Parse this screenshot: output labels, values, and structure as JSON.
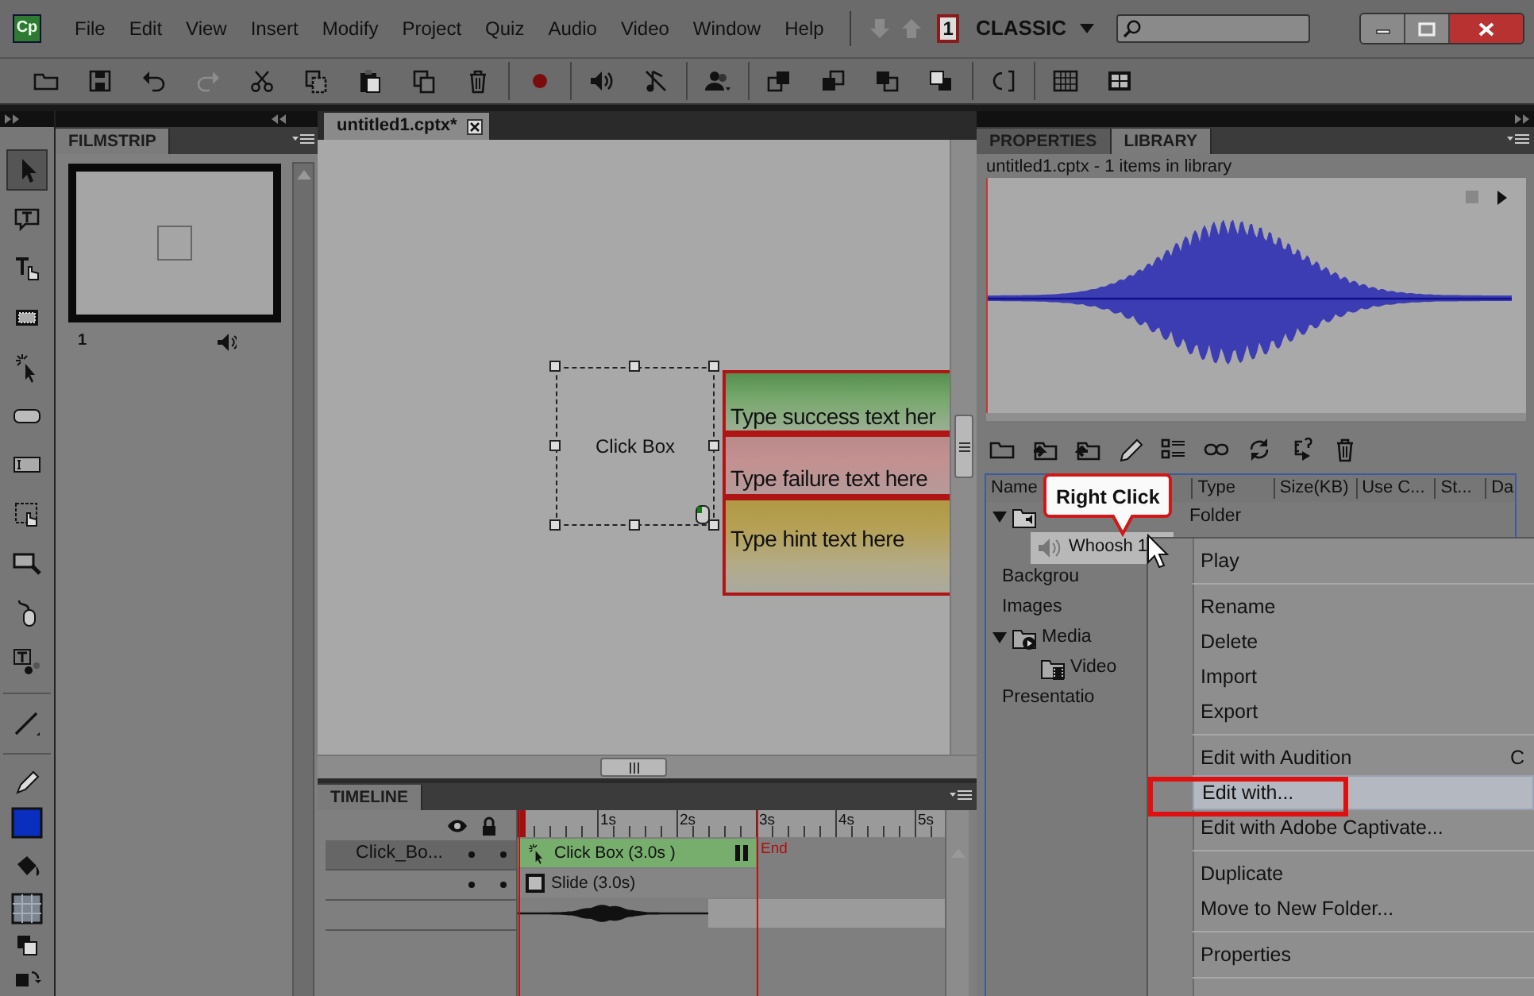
{
  "app": {
    "logo": "Cp",
    "menus": [
      "File",
      "Edit",
      "View",
      "Insert",
      "Modify",
      "Project",
      "Quiz",
      "Audio",
      "Video",
      "Window",
      "Help"
    ],
    "nav_arrows": [
      {
        "kind": "down",
        "disabled": true
      },
      {
        "kind": "up",
        "disabled": true
      }
    ],
    "page_indicator": "1",
    "workspace": "CLASSIC"
  },
  "toolbar": [
    {
      "kind": "open",
      "disabled": false
    },
    {
      "kind": "save",
      "disabled": false
    },
    {
      "kind": "undo",
      "disabled": false
    },
    {
      "kind": "redo",
      "disabled": true
    },
    {
      "kind": "cut",
      "disabled": false
    },
    {
      "kind": "copy",
      "disabled": false
    },
    {
      "kind": "paste",
      "disabled": false
    },
    {
      "kind": "duplicate",
      "disabled": false
    },
    {
      "kind": "delete",
      "disabled": false
    },
    {
      "kind": "sep"
    },
    {
      "kind": "record",
      "disabled": false
    },
    {
      "kind": "sep"
    },
    {
      "kind": "audio",
      "disabled": false
    },
    {
      "kind": "note",
      "disabled": false
    },
    {
      "kind": "sep"
    },
    {
      "kind": "people",
      "disabled": false
    },
    {
      "kind": "sep"
    },
    {
      "kind": "front",
      "disabled": false
    },
    {
      "kind": "forward",
      "disabled": false
    },
    {
      "kind": "backward",
      "disabled": false
    },
    {
      "kind": "back",
      "disabled": false
    },
    {
      "kind": "sep"
    },
    {
      "kind": "bracket",
      "disabled": false
    },
    {
      "kind": "sep"
    },
    {
      "kind": "grid",
      "disabled": false
    },
    {
      "kind": "grid2",
      "disabled": false
    }
  ],
  "tools": [
    {
      "kind": "pointer",
      "selected": true
    },
    {
      "kind": "caption",
      "selected": false
    },
    {
      "kind": "rollover",
      "selected": false
    },
    {
      "kind": "highlight",
      "selected": false
    },
    {
      "kind": "click",
      "selected": false
    },
    {
      "kind": "button",
      "selected": false
    },
    {
      "kind": "entry",
      "selected": false
    },
    {
      "kind": "area",
      "selected": false
    },
    {
      "kind": "zoom",
      "selected": false
    },
    {
      "kind": "mouse",
      "selected": false
    },
    {
      "kind": "smart",
      "selected": false
    },
    {
      "kind": "sep"
    },
    {
      "kind": "line",
      "selected": false
    },
    {
      "kind": "sep"
    },
    {
      "kind": "pencil",
      "selected": false
    },
    {
      "kind": "stroke",
      "color": "#0a2ebd"
    },
    {
      "kind": "fill",
      "selected": false
    },
    {
      "kind": "fillswatch"
    },
    {
      "kind": "defaults"
    },
    {
      "kind": "swap"
    }
  ],
  "filmstrip": {
    "tab": "FILMSTRIP",
    "slides": [
      {
        "number": "1",
        "selected": true,
        "audio": true
      }
    ]
  },
  "document": {
    "tab": "untitled1.cptx*",
    "click_box": {
      "label": "Click Box",
      "selected": true
    },
    "captions": [
      {
        "kind": "success",
        "text": "Type success text her"
      },
      {
        "kind": "failure",
        "text": "Type failure text here"
      },
      {
        "kind": "hint",
        "text": "Type hint text here"
      }
    ]
  },
  "timeline": {
    "tab": "TIMELINE",
    "ticks": [
      "1s",
      "2s",
      "3s",
      "4s",
      "5s"
    ],
    "end_label": "End",
    "layers": [
      {
        "kind": "object",
        "name": "Click_Bo...",
        "selected": true,
        "bar": "Click Box (3.0s )"
      },
      {
        "kind": "slide",
        "selected": false,
        "bar": "Slide (3.0s)"
      },
      {
        "kind": "audio",
        "selected": false
      }
    ]
  },
  "library": {
    "tabs": [
      {
        "label": "PROPERTIES",
        "selected": false
      },
      {
        "label": "LIBRARY",
        "selected": true
      }
    ],
    "summary": "untitled1.cptx - 1 items in library",
    "columns": [
      "Name",
      "Type",
      "Size(KB)",
      "Use C...",
      "St...",
      "Da"
    ],
    "items": [
      {
        "kind": "audio-folder",
        "type": "Folder",
        "expanded": true,
        "children": [
          {
            "kind": "audio",
            "name": "Whoosh 1",
            "selected": true
          }
        ]
      },
      {
        "kind": "folder",
        "name": "Backgrou"
      },
      {
        "kind": "folder",
        "name": "Images"
      },
      {
        "kind": "media-folder",
        "name": "Media",
        "expanded": true,
        "children": [
          {
            "kind": "video-folder",
            "name": "Video"
          }
        ]
      },
      {
        "kind": "chart-folder",
        "name": "Presentatio"
      }
    ]
  },
  "callout": {
    "text": "Right Click"
  },
  "context_menu": {
    "groups": [
      [
        {
          "label": "Play",
          "selected": false
        }
      ],
      [
        {
          "label": "Rename",
          "selected": false
        },
        {
          "label": "Delete",
          "selected": false
        },
        {
          "label": "Import",
          "selected": false
        },
        {
          "label": "Export",
          "selected": false
        }
      ],
      [
        {
          "label": "Edit with Audition",
          "shortcut": "C",
          "selected": false
        },
        {
          "label": "Edit with...",
          "selected": true
        },
        {
          "label": "Edit with Adobe Captivate...",
          "selected": false
        }
      ],
      [
        {
          "label": "Duplicate",
          "selected": false
        },
        {
          "label": "Move to New Folder...",
          "selected": false
        }
      ],
      [
        {
          "label": "Properties",
          "selected": false
        }
      ]
    ]
  }
}
